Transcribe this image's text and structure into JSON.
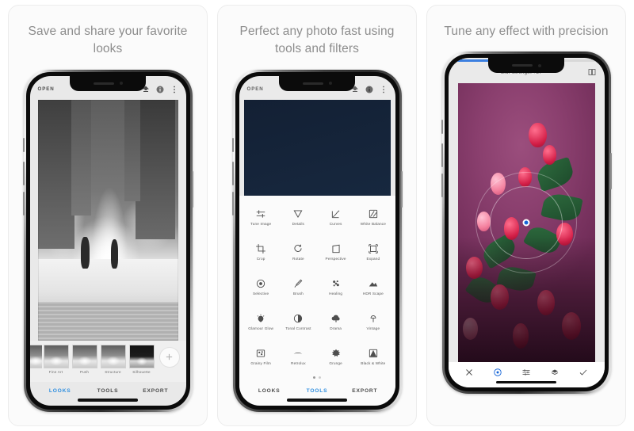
{
  "panels": [
    {
      "caption": "Save and share your favorite looks",
      "phone": {
        "topbar": {
          "open_label": "OPEN",
          "icons": [
            "export-icon",
            "info-icon",
            "overflow-menu-icon"
          ]
        },
        "filters": [
          {
            "label": "Fine Art"
          },
          {
            "label": "Push"
          },
          {
            "label": "Structure"
          },
          {
            "label": "Silhouette"
          }
        ],
        "add_look_label": "+",
        "tabs": [
          {
            "label": "LOOKS",
            "active": true
          },
          {
            "label": "TOOLS",
            "active": false
          },
          {
            "label": "EXPORT",
            "active": false
          }
        ]
      }
    },
    {
      "caption": "Perfect any photo fast using tools and filters",
      "phone": {
        "topbar": {
          "open_label": "OPEN",
          "icons": [
            "export-icon",
            "info-icon",
            "overflow-menu-icon"
          ]
        },
        "tools": [
          {
            "label": "Tune Image",
            "icon": "tune-image-icon"
          },
          {
            "label": "Details",
            "icon": "details-icon"
          },
          {
            "label": "Curves",
            "icon": "curves-icon"
          },
          {
            "label": "White Balance",
            "icon": "white-balance-icon"
          },
          {
            "label": "Crop",
            "icon": "crop-icon"
          },
          {
            "label": "Rotate",
            "icon": "rotate-icon"
          },
          {
            "label": "Perspective",
            "icon": "perspective-icon"
          },
          {
            "label": "Expand",
            "icon": "expand-icon"
          },
          {
            "label": "Selective",
            "icon": "selective-icon"
          },
          {
            "label": "Brush",
            "icon": "brush-icon"
          },
          {
            "label": "Healing",
            "icon": "healing-icon"
          },
          {
            "label": "HDR Scape",
            "icon": "hdr-scape-icon"
          },
          {
            "label": "Glamour Glow",
            "icon": "glamour-glow-icon"
          },
          {
            "label": "Tonal Contrast",
            "icon": "tonal-contrast-icon"
          },
          {
            "label": "Drama",
            "icon": "drama-icon"
          },
          {
            "label": "Vintage",
            "icon": "vintage-icon"
          },
          {
            "label": "Grainy Film",
            "icon": "grainy-film-icon"
          },
          {
            "label": "Retrolux",
            "icon": "retrolux-icon"
          },
          {
            "label": "Grunge",
            "icon": "grunge-icon"
          },
          {
            "label": "Black & White",
            "icon": "black-white-icon"
          }
        ],
        "tabs": [
          {
            "label": "LOOKS",
            "active": false
          },
          {
            "label": "TOOLS",
            "active": true
          },
          {
            "label": "EXPORT",
            "active": false
          }
        ]
      }
    },
    {
      "caption": "Tune any effect with precision",
      "phone": {
        "topbar": {
          "title": "Blur Strength +27",
          "icons": [
            "compare-icon"
          ]
        },
        "slider": {
          "value_percent": 42,
          "accent_color": "#3b7fe0"
        },
        "bottom_icons": [
          {
            "icon": "close-icon",
            "active": false
          },
          {
            "icon": "lens-blur-icon",
            "active": true
          },
          {
            "icon": "adjust-sliders-icon",
            "active": false
          },
          {
            "icon": "stack-layers-icon",
            "active": false
          },
          {
            "icon": "check-icon",
            "active": false
          }
        ]
      }
    }
  ],
  "colors": {
    "accent": "#2f8fe0",
    "slider": "#3b7fe0",
    "caption": "#8d8d8d"
  }
}
